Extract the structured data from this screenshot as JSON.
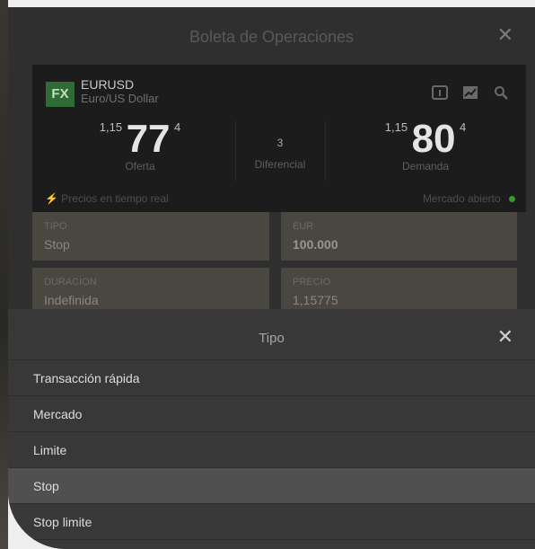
{
  "dialog": {
    "title": "Boleta de Operaciones",
    "close": "✕"
  },
  "instrument": {
    "badge": "FX",
    "symbol": "EURUSD",
    "description": "Euro/US Dollar"
  },
  "toolbar_icons": [
    "info-icon",
    "chart-icon",
    "search-icon"
  ],
  "quote": {
    "bid": {
      "prefix": "1,15",
      "big": "77",
      "sup": "4",
      "label": "Oferta"
    },
    "spread": {
      "value": "3",
      "label": "Diferencial"
    },
    "ask": {
      "prefix": "1,15",
      "big": "80",
      "sup": "4",
      "label": "Demanda"
    },
    "realtime": "Precios en tiempo real",
    "market": "Mercado abierto"
  },
  "fields": {
    "type": {
      "label": "TIPO",
      "value": "Stop"
    },
    "amount": {
      "label": "EUR",
      "value": "100.000"
    },
    "duration": {
      "label": "DURACION",
      "value": "Indefinida"
    },
    "price": {
      "label": "PRECIO",
      "value": "1,15775"
    }
  },
  "sheet": {
    "title": "Tipo",
    "close": "✕",
    "options": [
      "Transacción rápida",
      "Mercado",
      "Limite",
      "Stop",
      "Stop limite"
    ],
    "selected": "Stop"
  },
  "colors": {
    "panel": "#2f2f2f",
    "quote_bg": "#1c1c1c",
    "badge": "#2f6b34",
    "live": "#3aa844"
  }
}
